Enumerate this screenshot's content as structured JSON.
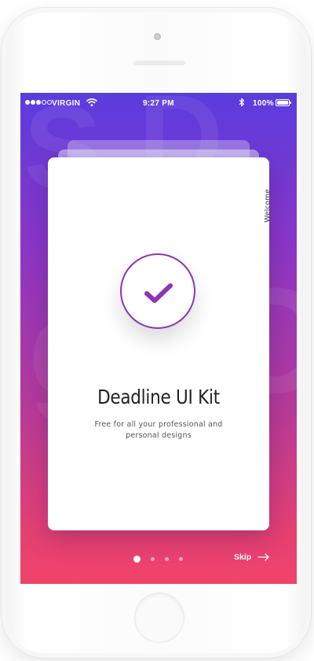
{
  "status_bar": {
    "carrier": "VIRGIN",
    "time": "9:27 PM",
    "battery": "100%",
    "signal_bars_filled": 3,
    "signal_bars_total": 5
  },
  "card": {
    "side_label": "Welcome",
    "title": "Deadline UI Kit",
    "subtitle": "Free for all your professional and personal designs",
    "icon": "checkmark-icon"
  },
  "pagination": {
    "total": 4,
    "active_index": 0
  },
  "skip": {
    "label": "Skip",
    "icon": "arrow-right-icon"
  },
  "colors": {
    "gradient_top": "#5a3cde",
    "gradient_bottom": "#f04369",
    "accent": "#8f33b4"
  }
}
